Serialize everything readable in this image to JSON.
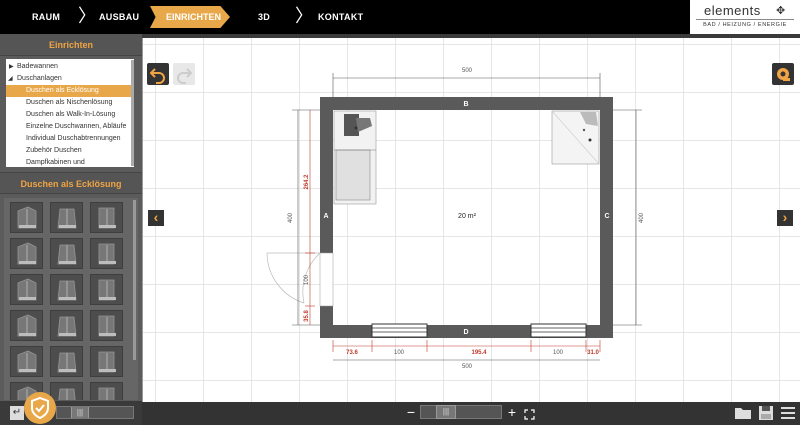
{
  "nav": {
    "steps": [
      {
        "label": "RAUM",
        "state": "done"
      },
      {
        "label": "AUSBAU",
        "state": "done"
      },
      {
        "label": "EINRICHTEN",
        "state": "active"
      },
      {
        "label": "3D",
        "state": "todo"
      },
      {
        "label": "KONTAKT",
        "state": "todo"
      }
    ],
    "accent": "#e8a84a"
  },
  "brand": {
    "name": "elements",
    "tagline": "BAD / HEIZUNG / ENERGIE"
  },
  "sidebar": {
    "title": "Einrichten",
    "tree": [
      {
        "label": "Badewannen",
        "expanded": false,
        "indent": 0
      },
      {
        "label": "Duschanlagen",
        "expanded": true,
        "indent": 0
      },
      {
        "label": "Duschen als Ecklösung",
        "selected": true,
        "indent": 1
      },
      {
        "label": "Duschen als Nischenlösung",
        "indent": 1
      },
      {
        "label": "Duschen als Walk-In-Lösung",
        "indent": 1
      },
      {
        "label": "Einzelne Duschwannen, Abläufe",
        "indent": 1
      },
      {
        "label": "Individual Duschabtrennungen",
        "indent": 1
      },
      {
        "label": "Zubehör Duschen",
        "indent": 1
      },
      {
        "label": "Dampfkabinen und",
        "indent": 1
      }
    ],
    "section_title": "Duschen als Ecklösung"
  },
  "plan": {
    "room_area": "20 m²",
    "wall_labels": {
      "top": "B",
      "left": "A",
      "right": "C",
      "bottom": "D"
    },
    "dims": {
      "top_total": "500",
      "bottom_total": "500",
      "left_total": "400",
      "right_total": "400",
      "left_segment_upper": "264.2",
      "left_door": "100",
      "left_segment_lower": "35.8",
      "bottom_segments": [
        "73.6",
        "100",
        "195.4",
        "100",
        "31.0"
      ]
    }
  },
  "colors": {
    "wall": "#5a5a5a",
    "dimension_red": "#c0392b",
    "dimension_gray": "#555555"
  }
}
